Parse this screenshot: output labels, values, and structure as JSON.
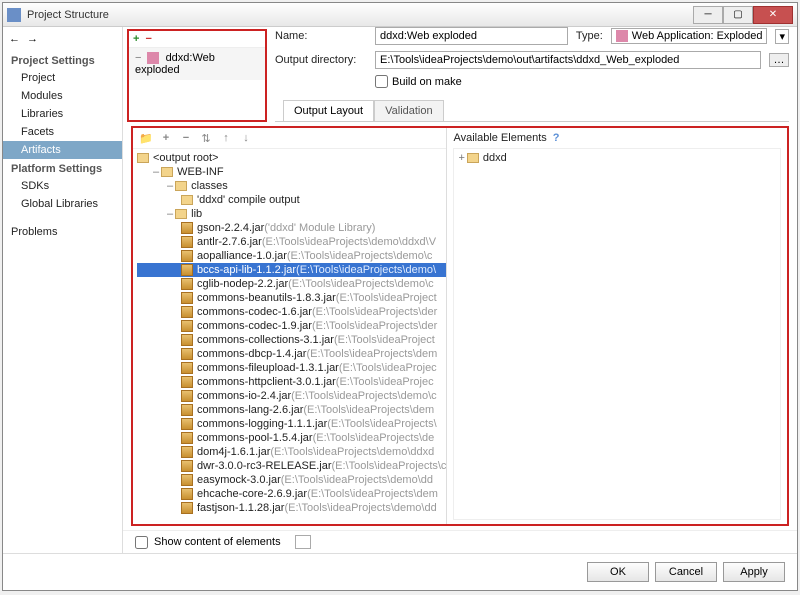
{
  "window": {
    "title": "Project Structure"
  },
  "sidebar": {
    "heads": {
      "project": "Project Settings",
      "platform": "Platform Settings"
    },
    "items": {
      "project": "Project",
      "modules": "Modules",
      "libraries": "Libraries",
      "facets": "Facets",
      "artifacts": "Artifacts",
      "sdks": "SDKs",
      "globalLibraries": "Global Libraries",
      "problems": "Problems"
    }
  },
  "artifactList": {
    "item": "ddxd:Web exploded"
  },
  "fields": {
    "nameLabel": "Name:",
    "nameValue": "ddxd:Web exploded",
    "typeLabel": "Type:",
    "typeValue": "Web Application: Exploded",
    "outDirLabel": "Output directory:",
    "outDirValue": "E:\\Tools\\ideaProjects\\demo\\out\\artifacts\\ddxd_Web_exploded",
    "buildOnMake": "Build on make"
  },
  "tabs": {
    "output": "Output Layout",
    "validation": "Validation"
  },
  "tree": {
    "root": "<output root>",
    "webinf": "WEB-INF",
    "classes": "classes",
    "compileOutput": "'ddxd' compile output",
    "lib": "lib",
    "jars": [
      {
        "name": "gson-2.2.4.jar",
        "path": "('ddxd' Module Library)",
        "sel": false
      },
      {
        "name": "antlr-2.7.6.jar",
        "path": "(E:\\Tools\\ideaProjects\\demo\\ddxd\\V",
        "sel": false
      },
      {
        "name": "aopalliance-1.0.jar",
        "path": "(E:\\Tools\\ideaProjects\\demo\\c",
        "sel": false
      },
      {
        "name": "bccs-api-lib-1.1.2.jar",
        "path": "(E:\\Tools\\ideaProjects\\demo\\",
        "sel": true
      },
      {
        "name": "cglib-nodep-2.2.jar",
        "path": "(E:\\Tools\\ideaProjects\\demo\\c",
        "sel": false
      },
      {
        "name": "commons-beanutils-1.8.3.jar",
        "path": "(E:\\Tools\\ideaProject",
        "sel": false
      },
      {
        "name": "commons-codec-1.6.jar",
        "path": "(E:\\Tools\\ideaProjects\\der",
        "sel": false
      },
      {
        "name": "commons-codec-1.9.jar",
        "path": "(E:\\Tools\\ideaProjects\\der",
        "sel": false
      },
      {
        "name": "commons-collections-3.1.jar",
        "path": "(E:\\Tools\\ideaProject",
        "sel": false
      },
      {
        "name": "commons-dbcp-1.4.jar",
        "path": "(E:\\Tools\\ideaProjects\\dem",
        "sel": false
      },
      {
        "name": "commons-fileupload-1.3.1.jar",
        "path": "(E:\\Tools\\ideaProjec",
        "sel": false
      },
      {
        "name": "commons-httpclient-3.0.1.jar",
        "path": "(E:\\Tools\\ideaProjec",
        "sel": false
      },
      {
        "name": "commons-io-2.4.jar",
        "path": "(E:\\Tools\\ideaProjects\\demo\\c",
        "sel": false
      },
      {
        "name": "commons-lang-2.6.jar",
        "path": "(E:\\Tools\\ideaProjects\\dem",
        "sel": false
      },
      {
        "name": "commons-logging-1.1.1.jar",
        "path": "(E:\\Tools\\ideaProjects\\",
        "sel": false
      },
      {
        "name": "commons-pool-1.5.4.jar",
        "path": "(E:\\Tools\\ideaProjects\\de",
        "sel": false
      },
      {
        "name": "dom4j-1.6.1.jar",
        "path": "(E:\\Tools\\ideaProjects\\demo\\ddxd",
        "sel": false
      },
      {
        "name": "dwr-3.0.0-rc3-RELEASE.jar",
        "path": "(E:\\Tools\\ideaProjects\\c",
        "sel": false
      },
      {
        "name": "easymock-3.0.jar",
        "path": "(E:\\Tools\\ideaProjects\\demo\\dd",
        "sel": false
      },
      {
        "name": "ehcache-core-2.6.9.jar",
        "path": "(E:\\Tools\\ideaProjects\\dem",
        "sel": false
      },
      {
        "name": "fastjson-1.1.28.jar",
        "path": "(E:\\Tools\\ideaProjects\\demo\\dd",
        "sel": false
      }
    ]
  },
  "available": {
    "head": "Available Elements",
    "item": "ddxd"
  },
  "footer": {
    "showContent": "Show content of elements"
  },
  "buttons": {
    "ok": "OK",
    "cancel": "Cancel",
    "apply": "Apply"
  }
}
